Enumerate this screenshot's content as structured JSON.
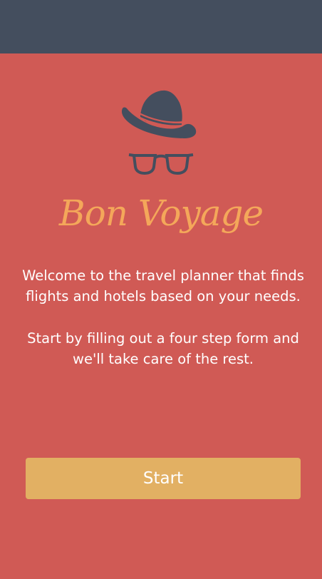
{
  "colors": {
    "background": "#d05a55",
    "top_bar": "#444e5e",
    "brand": "#f4a75a",
    "button": "#e2b063",
    "text": "#ffffff",
    "icon": "#444e5e"
  },
  "logo": {
    "icons": [
      "fedora-hat-icon",
      "glasses-icon"
    ]
  },
  "brand": {
    "title": "Bon Voyage"
  },
  "intro": {
    "paragraph1": "Welcome to the travel planner that finds flights and hotels based on your needs.",
    "paragraph2": "Start by filling out a four step form and we'll take care of the rest."
  },
  "actions": {
    "start_label": "Start"
  }
}
